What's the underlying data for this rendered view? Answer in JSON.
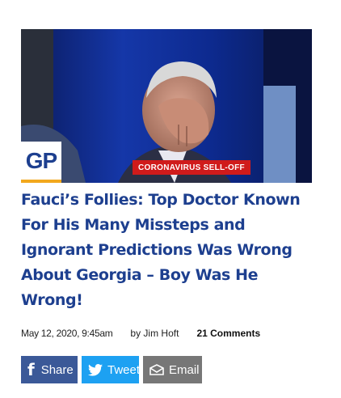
{
  "article": {
    "image_chyron": "CORONAVIRUS SELL-OFF",
    "site_logo": "GP",
    "headline": "Fauci’s Follies: Top Doctor Known For His Many Missteps and Ignorant Predictions Was Wrong About Georgia – Boy Was He Wrong!",
    "date": "May 12, 2020, 9:45am",
    "author": "by Jim Hoft",
    "comments": "21 Comments"
  },
  "share": {
    "facebook_label": "Share",
    "twitter_label": "Tweet",
    "email_label": "Email"
  },
  "colors": {
    "headline": "#1d3f8f",
    "facebook": "#3b5998",
    "twitter": "#1da1f2",
    "email": "#777777",
    "chyron": "#d01b1b",
    "logo_accent": "#f2a81d"
  },
  "icons": {
    "facebook": "facebook-icon",
    "twitter": "twitter-bird-icon",
    "email": "envelope-icon"
  }
}
